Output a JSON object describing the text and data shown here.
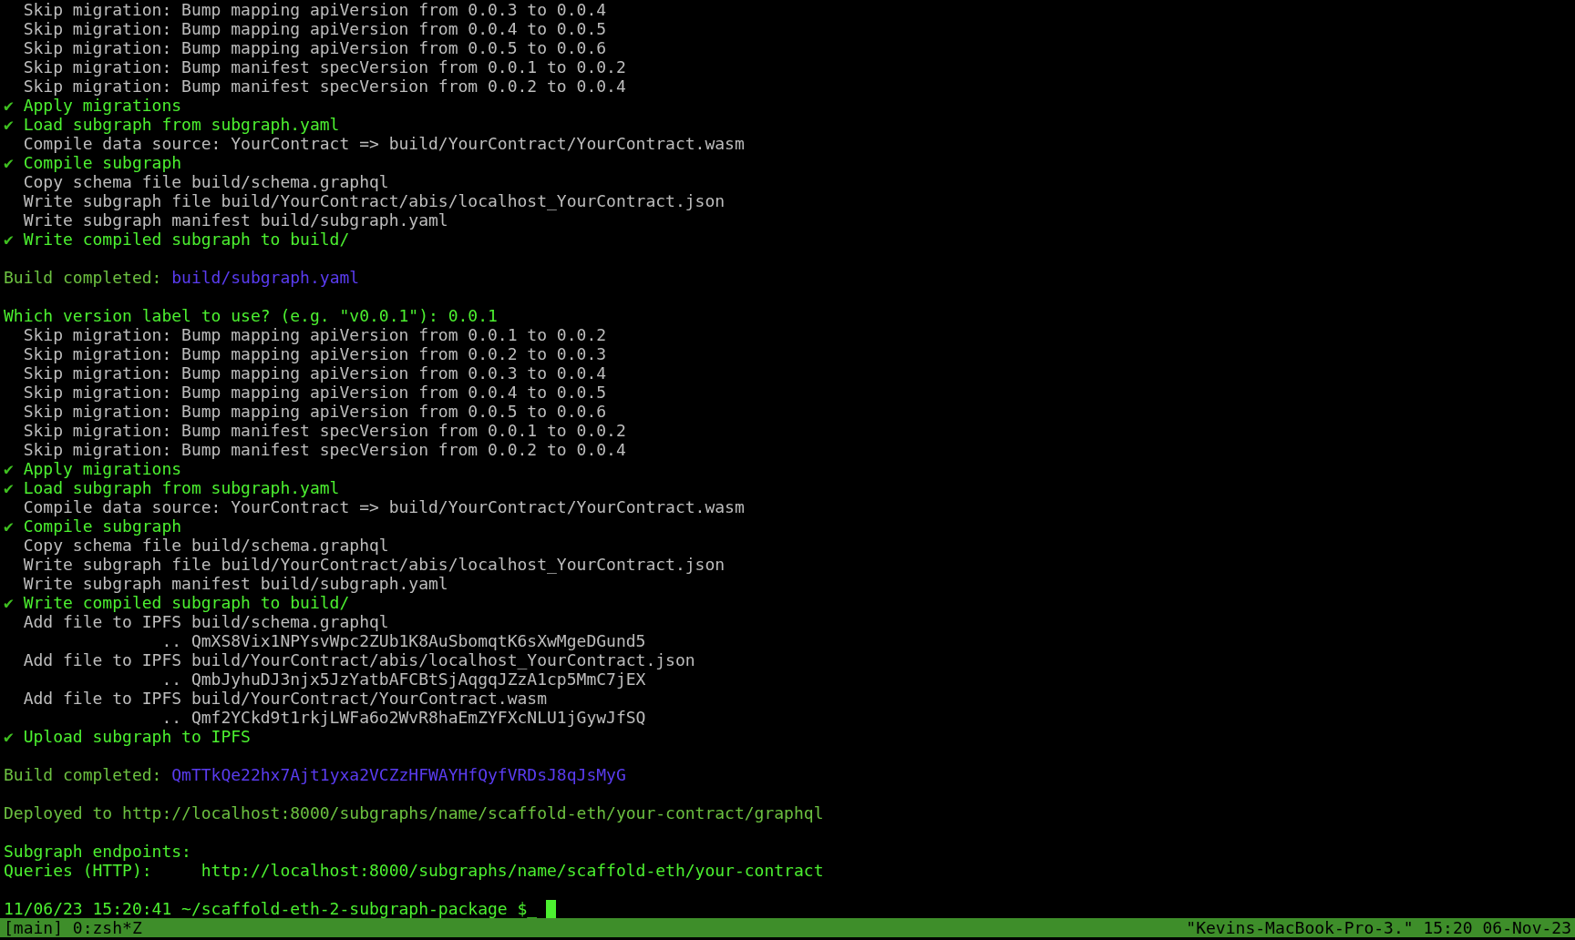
{
  "terminal": {
    "lines": [
      {
        "kind": "step",
        "text": "Skip migration: Bump mapping apiVersion from 0.0.3 to 0.0.4"
      },
      {
        "kind": "step",
        "text": "Skip migration: Bump mapping apiVersion from 0.0.4 to 0.0.5"
      },
      {
        "kind": "step",
        "text": "Skip migration: Bump mapping apiVersion from 0.0.5 to 0.0.6"
      },
      {
        "kind": "step",
        "text": "Skip migration: Bump manifest specVersion from 0.0.1 to 0.0.2"
      },
      {
        "kind": "step",
        "text": "Skip migration: Bump manifest specVersion from 0.0.2 to 0.0.4"
      },
      {
        "kind": "check",
        "mark": "✔",
        "text": "Apply migrations"
      },
      {
        "kind": "check",
        "mark": "✔",
        "text": "Load subgraph from subgraph.yaml"
      },
      {
        "kind": "step",
        "text": "Compile data source: YourContract => build/YourContract/YourContract.wasm"
      },
      {
        "kind": "check",
        "mark": "✔",
        "text": "Compile subgraph"
      },
      {
        "kind": "step",
        "text": "Copy schema file build/schema.graphql"
      },
      {
        "kind": "step",
        "text": "Write subgraph file build/YourContract/abis/localhost_YourContract.json"
      },
      {
        "kind": "step",
        "text": "Write subgraph manifest build/subgraph.yaml"
      },
      {
        "kind": "check",
        "mark": "✔",
        "text": "Write compiled subgraph to build/"
      },
      {
        "kind": "blank"
      },
      {
        "kind": "result",
        "text": "Build completed: ",
        "link": "build/subgraph.yaml"
      },
      {
        "kind": "blank"
      },
      {
        "kind": "heading",
        "text": "Which version label to use? (e.g. \"v0.0.1\"): 0.0.1"
      },
      {
        "kind": "step",
        "text": "Skip migration: Bump mapping apiVersion from 0.0.1 to 0.0.2"
      },
      {
        "kind": "step",
        "text": "Skip migration: Bump mapping apiVersion from 0.0.2 to 0.0.3"
      },
      {
        "kind": "step",
        "text": "Skip migration: Bump mapping apiVersion from 0.0.3 to 0.0.4"
      },
      {
        "kind": "step",
        "text": "Skip migration: Bump mapping apiVersion from 0.0.4 to 0.0.5"
      },
      {
        "kind": "step",
        "text": "Skip migration: Bump mapping apiVersion from 0.0.5 to 0.0.6"
      },
      {
        "kind": "step",
        "text": "Skip migration: Bump manifest specVersion from 0.0.1 to 0.0.2"
      },
      {
        "kind": "step",
        "text": "Skip migration: Bump manifest specVersion from 0.0.2 to 0.0.4"
      },
      {
        "kind": "check",
        "mark": "✔",
        "text": "Apply migrations"
      },
      {
        "kind": "check",
        "mark": "✔",
        "text": "Load subgraph from subgraph.yaml"
      },
      {
        "kind": "step",
        "text": "Compile data source: YourContract => build/YourContract/YourContract.wasm"
      },
      {
        "kind": "check",
        "mark": "✔",
        "text": "Compile subgraph"
      },
      {
        "kind": "step",
        "text": "Copy schema file build/schema.graphql"
      },
      {
        "kind": "step",
        "text": "Write subgraph file build/YourContract/abis/localhost_YourContract.json"
      },
      {
        "kind": "step",
        "text": "Write subgraph manifest build/subgraph.yaml"
      },
      {
        "kind": "check",
        "mark": "✔",
        "text": "Write compiled subgraph to build/"
      },
      {
        "kind": "step",
        "text": "Add file to IPFS build/schema.graphql"
      },
      {
        "kind": "step",
        "text": "              .. QmXS8Vix1NPYsvWpc2ZUb1K8AuSbomqtK6sXwMgeDGund5"
      },
      {
        "kind": "step",
        "text": "Add file to IPFS build/YourContract/abis/localhost_YourContract.json"
      },
      {
        "kind": "step",
        "text": "              .. QmbJyhuDJ3njx5JzYatbAFCBtSjAqgqJZzA1cp5MmC7jEX"
      },
      {
        "kind": "step",
        "text": "Add file to IPFS build/YourContract/YourContract.wasm"
      },
      {
        "kind": "step",
        "text": "              .. Qmf2YCkd9t1rkjLWFa6o2WvR8haEmZYFXcNLU1jGywJfSQ"
      },
      {
        "kind": "check",
        "mark": "✔",
        "text": "Upload subgraph to IPFS"
      },
      {
        "kind": "blank"
      },
      {
        "kind": "result",
        "text": "Build completed: ",
        "link": "QmTTkQe22hx7Ajt1yxa2VCZzHFWAYHfQyfVRDsJ8qJsMyG"
      },
      {
        "kind": "blank"
      },
      {
        "kind": "note",
        "text": "Deployed to http://localhost:8000/subgraphs/name/scaffold-eth/your-contract/graphql"
      },
      {
        "kind": "blank"
      },
      {
        "kind": "heading",
        "text": "Subgraph endpoints:"
      },
      {
        "kind": "heading",
        "text": "Queries (HTTP):     http://localhost:8000/subgraphs/name/scaffold-eth/your-contract"
      },
      {
        "kind": "blank"
      },
      {
        "kind": "prompt",
        "text": "11/06/23 15:20:41 ~/scaffold-eth-2-subgraph-package $_"
      }
    ]
  },
  "status_bar": {
    "left": "[main] 0:zsh*Z",
    "right": "\"Kevins-MacBook-Pro-3.\" 15:20 06-Nov-23"
  }
}
